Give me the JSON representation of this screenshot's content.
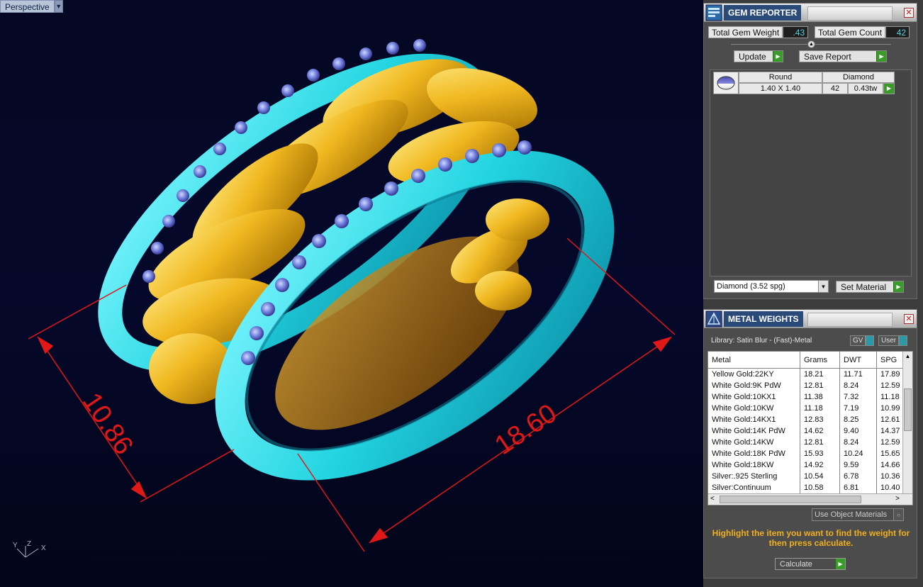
{
  "viewport": {
    "label": "Perspective",
    "dimensions": {
      "height": "10.86",
      "width": "18.60"
    },
    "axes": {
      "y": "Y",
      "z": "Z",
      "x": "X"
    }
  },
  "gem_reporter": {
    "title": "GEM REPORTER",
    "total_weight_label": "Total Gem Weight",
    "total_weight_value": ".43",
    "total_count_label": "Total Gem Count",
    "total_count_value": "42",
    "update_label": "Update",
    "save_report_label": "Save Report",
    "gem": {
      "shape": "Round",
      "type": "Diamond",
      "size": "1.40 X 1.40",
      "count": "42",
      "weight": "0.43tw"
    },
    "material_select": "Diamond    (3.52 spg)",
    "set_material_label": "Set Material"
  },
  "metal_weights": {
    "title": "METAL WEIGHTS",
    "library": "Library: Satin Blur - (Fast)-Metal",
    "toggle_gv": "GV",
    "toggle_user": "User",
    "columns": [
      "Metal",
      "Grams",
      "DWT",
      "SPG"
    ],
    "rows": [
      [
        "Yellow Gold:22KY",
        "18.21",
        "11.71",
        "17.89"
      ],
      [
        "White Gold:9K PdW",
        "12.81",
        "8.24",
        "12.59"
      ],
      [
        "White Gold:10KX1",
        "11.38",
        "7.32",
        "11.18"
      ],
      [
        "White Gold:10KW",
        "11.18",
        "7.19",
        "10.99"
      ],
      [
        "White Gold:14KX1",
        "12.83",
        "8.25",
        "12.61"
      ],
      [
        "White Gold:14K PdW",
        "14.62",
        "9.40",
        "14.37"
      ],
      [
        "White Gold:14KW",
        "12.81",
        "8.24",
        "12.59"
      ],
      [
        "White Gold:18K PdW",
        "15.93",
        "10.24",
        "15.65"
      ],
      [
        "White Gold:18KW",
        "14.92",
        "9.59",
        "14.66"
      ],
      [
        "Silver:.925 Sterling",
        "10.54",
        "6.78",
        "10.36"
      ],
      [
        "Silver:Continuum",
        "10.58",
        "6.81",
        "10.40"
      ]
    ],
    "use_object_materials": "Use Object Materials",
    "hint": "Highlight the item you want to find the weight for then press calculate.",
    "calculate_label": "Calculate"
  }
}
